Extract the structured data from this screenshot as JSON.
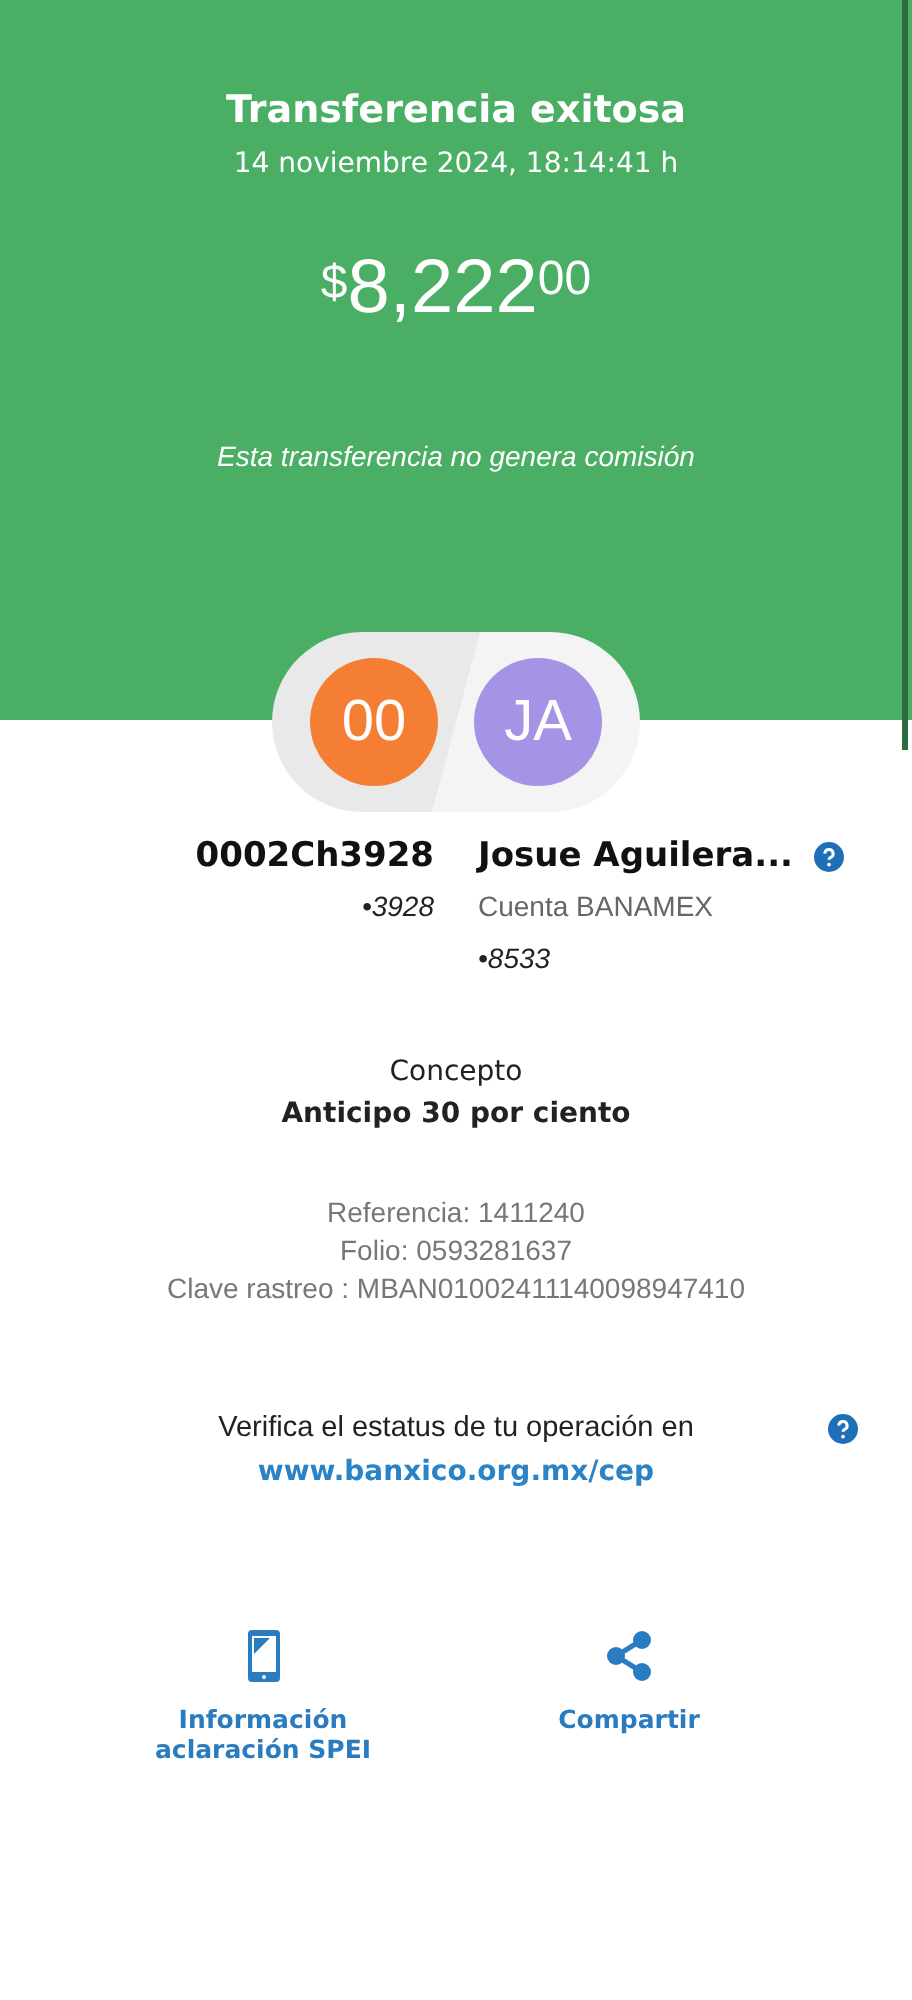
{
  "header": {
    "title": "Transferencia exitosa",
    "date": "14 noviembre 2024, 18:14:41 h",
    "amount": {
      "currency": "$",
      "integer": "8,222",
      "cents": "00"
    },
    "note": "Esta transferencia no genera comisión"
  },
  "parties": [
    {
      "initials": "00",
      "color": "#f47f34",
      "name": "0002Ch3928",
      "lines": [
        {
          "kind": "number",
          "text": "•3928"
        }
      ],
      "help": false
    },
    {
      "initials": "JA",
      "color": "#a593e6",
      "name": "Josue Aguilera...",
      "lines": [
        {
          "kind": "bank",
          "text": "Cuenta BANAMEX"
        },
        {
          "kind": "number",
          "text": "•8533"
        }
      ],
      "help": true
    }
  ],
  "concept": {
    "label": "Concepto",
    "value": "Anticipo 30 por ciento"
  },
  "references": [
    "Referencia: 1411240",
    "Folio: 0593281637",
    "Clave rastreo : MBAN01002411140098947410"
  ],
  "verify": {
    "text": "Verifica el estatus de tu operación en",
    "link": "www.banxico.org.mx/cep"
  },
  "actions": [
    {
      "kind": "phone",
      "label": "Información aclaración SPEI"
    },
    {
      "kind": "share",
      "label": "Compartir"
    }
  ]
}
